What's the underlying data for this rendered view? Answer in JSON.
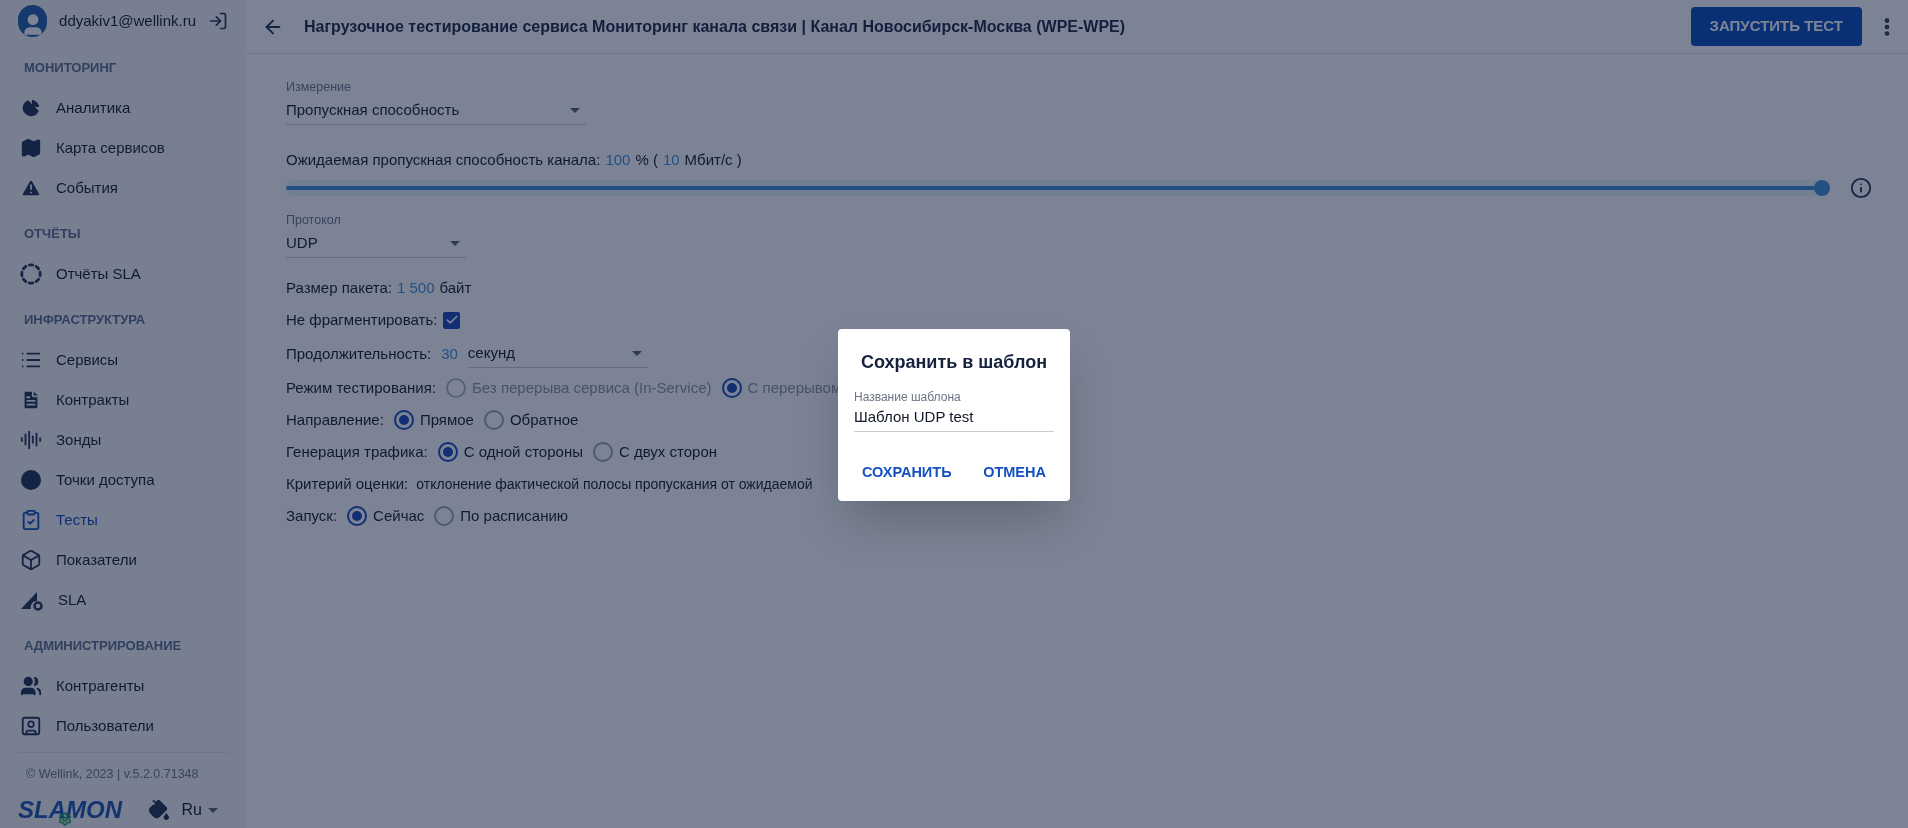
{
  "user": {
    "email": "ddyakiv1@wellink.ru"
  },
  "sidebar": {
    "sections": [
      {
        "title": "МОНИТОРИНГ",
        "items": [
          {
            "label": "Аналитика",
            "selected": false
          },
          {
            "label": "Карта сервисов",
            "selected": false
          },
          {
            "label": "События",
            "selected": false
          }
        ]
      },
      {
        "title": "ОТЧЁТЫ",
        "items": [
          {
            "label": "Отчёты SLA",
            "selected": false
          }
        ]
      },
      {
        "title": "ИНФРАСТРУКТУРА",
        "items": [
          {
            "label": "Сервисы",
            "selected": false
          },
          {
            "label": "Контракты",
            "selected": false
          },
          {
            "label": "Зонды",
            "selected": false
          },
          {
            "label": "Точки доступа",
            "selected": false
          },
          {
            "label": "Тесты",
            "selected": true
          },
          {
            "label": "Показатели",
            "selected": false
          },
          {
            "label": "SLA",
            "selected": false
          }
        ]
      },
      {
        "title": "АДМИНИСТРИРОВАНИЕ",
        "items": [
          {
            "label": "Контрагенты",
            "selected": false
          },
          {
            "label": "Пользователи",
            "selected": false
          }
        ]
      }
    ],
    "footer": {
      "copyright": "© Wellink, 2023 | v.5.2.0.71348",
      "logo_left": "SLA",
      "logo_right": "MON",
      "language": "Ru"
    }
  },
  "header": {
    "title": "Нагрузочное тестирование сервиса Мониторинг канала связи | Канал Новосибирск-Москва (WPE-WPE)",
    "button": "ЗАПУСТИТЬ ТЕСТ"
  },
  "form": {
    "measurement": {
      "label": "Измерение",
      "value": "Пропускная способность"
    },
    "bandwidth": {
      "label": "Ожидаемая пропускная способность канала:",
      "value": "100",
      "unit": "% (",
      "value2": "10",
      "unit2": "Мбит/с )",
      "level": 1
    },
    "protocol": {
      "label": "Протокол",
      "value": "UDP"
    },
    "packet": {
      "label": "Размер пакета:",
      "value": "1 500",
      "unit": "байт"
    },
    "no_fragment": {
      "label": "Не фрагментировать:",
      "checked": true
    },
    "duration": {
      "label": "Продолжительность:",
      "value": "30",
      "unit": "секунд"
    },
    "radio_groups": [
      {
        "label": "Режим тестирования:",
        "options": [
          {
            "label": "Без перерыва сервиса (In-Service)",
            "selected": false,
            "disabled": true
          },
          {
            "label": "С перерывом",
            "selected": true,
            "disabled": true
          }
        ]
      },
      {
        "label": "Направление:",
        "options": [
          {
            "label": "Прямое",
            "selected": true,
            "disabled": false
          },
          {
            "label": "Обратное",
            "selected": false,
            "disabled": false
          }
        ]
      },
      {
        "label": "Генерация трафика:",
        "options": [
          {
            "label": "С одной стороны",
            "selected": true,
            "disabled": false
          },
          {
            "label": "С двух сторон",
            "selected": false,
            "disabled": false
          }
        ]
      }
    ],
    "criterion": {
      "label": "Критерий оценки:",
      "value": "отклонение фактической полосы пропускания от ожидаемой"
    },
    "launch": {
      "label": "Запуск:",
      "options": [
        {
          "label": "Сейчас",
          "selected": true,
          "disabled": false
        },
        {
          "label": "По расписанию",
          "selected": false,
          "disabled": false
        }
      ]
    }
  },
  "dialog": {
    "title": "Сохранить в шаблон",
    "field_label": "Название шаблона",
    "value": "Шаблон UDP test",
    "buttons": [
      "СОХРАНИТЬ",
      "ОТМЕНА"
    ]
  }
}
